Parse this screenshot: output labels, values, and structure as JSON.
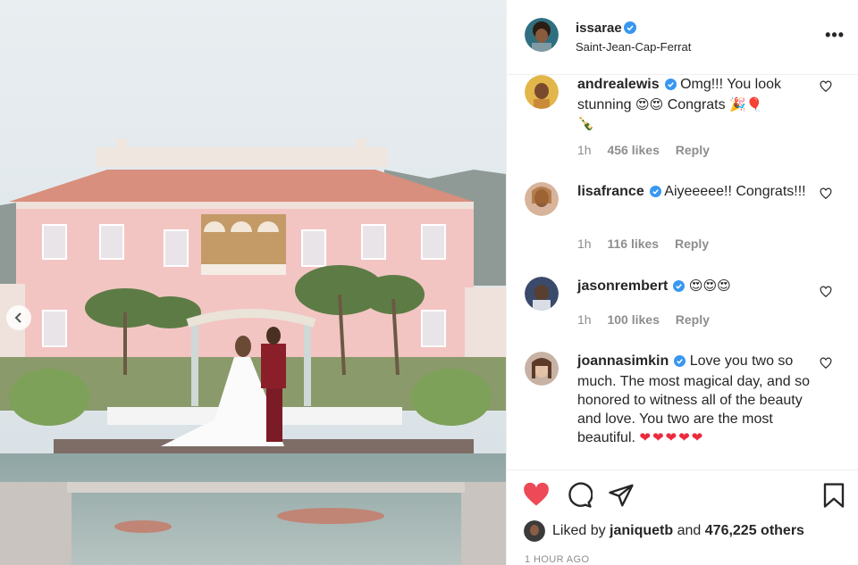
{
  "post": {
    "username": "issarae",
    "location": "Saint-Jean-Cap-Ferrat",
    "more_icon": "more-options-icon"
  },
  "comments": [
    {
      "user": "andrealewis",
      "text": "Omg!!! You look stunning",
      "emoji1": "😍😍",
      "text2": "Congrats",
      "emoji2": "🎉🎈",
      "emoji3": "🍾",
      "time": "1h",
      "likes": "456 likes",
      "reply": "Reply"
    },
    {
      "user": "lisafrance",
      "text": "Aiyeeeee!! Congrats!!!",
      "time": "1h",
      "likes": "116 likes",
      "reply": "Reply"
    },
    {
      "user": "jasonrembert",
      "emoji1": "😍😍😍",
      "time": "1h",
      "likes": "100 likes",
      "reply": "Reply"
    },
    {
      "user": "joannasimkin",
      "text": "Love you two so much. The most magical day, and so honored to witness all of the beauty and love. You two are the most beautiful.",
      "emoji1": "❤❤❤❤❤"
    }
  ],
  "liked_by": {
    "prefix": "Liked by",
    "user": "janiquetb",
    "joiner": "and",
    "others": "476,225 others"
  },
  "timestamp": "1 HOUR AGO",
  "colors": {
    "heart_red": "#ed4956",
    "verified_blue": "#3897f0",
    "muted": "#8e8e8e"
  }
}
